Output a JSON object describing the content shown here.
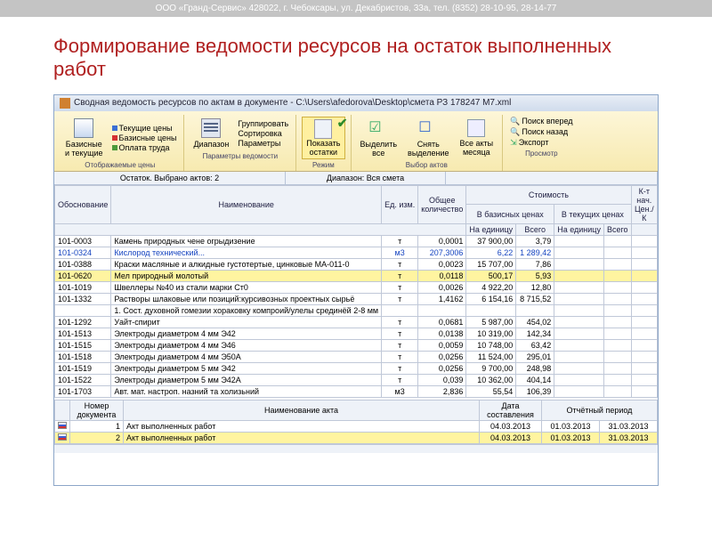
{
  "page": {
    "header": "ООО «Гранд-Сервис» 428022, г. Чебоксары, ул. Декабристов, 33а, тел. (8352) 28-10-95, 28-14-77",
    "title": "Формирование ведомости ресурсов на остаток выполненных работ"
  },
  "window": {
    "title": "Сводная ведомость ресурсов по актам в документе - C:\\Users\\afedorova\\Desktop\\смета РЗ 178247 М7.xml"
  },
  "ribbon": {
    "g1": {
      "big": "Базисные\nи текущие",
      "i1": "Текущие цены",
      "i2": "Базисные цены",
      "i3": "Оплата труда",
      "label": "Отображаемые цены"
    },
    "g2": {
      "big": "Диапазон",
      "i1": "Группировать",
      "i2": "Сортировка",
      "i3": "Параметры",
      "label": "Параметры ведомости"
    },
    "g3": {
      "big": "Показать\nостатки",
      "label": "Режим"
    },
    "g4": {
      "b1": "Выделить\nвсе",
      "b2": "Снять\nвыделение",
      "b3": "Все акты\nмесяца",
      "label": "Выбор актов"
    },
    "g5": {
      "i1": "Поиск вперед",
      "i2": "Поиск назад",
      "i3": "Экспорт",
      "label": "Просмотр"
    }
  },
  "subheader": {
    "s1": "Остаток. Выбрано актов: 2",
    "s2": "Диапазон: Вся смета"
  },
  "columns": {
    "code": "Обоснование",
    "name": "Наименование",
    "unit": "Ед. изм.",
    "qty_group": "Общее\nколичество",
    "base_group": "В базисных ценах",
    "cur_group": "В текущих ценах",
    "perunit": "На единицу",
    "total": "Всего",
    "right": "К-т\nнач.\nЦен./К"
  },
  "main_group": "Стоимость",
  "rows": [
    {
      "code": "101-0003",
      "name": "Камень природных чене огрыдизение",
      "unit": "т",
      "n1": "0,0001",
      "n2": "37 900,00",
      "n3": "3,79"
    },
    {
      "code": "101-0324",
      "name": "Кислород технический...",
      "unit": "м3",
      "n1": "207,3006",
      "n2": "6,22",
      "n3": "1 289,42",
      "blue": true
    },
    {
      "code": "101-0388",
      "name": "Краски масляные и алкидные густотертые, цинковые МА-011-0",
      "unit": "т",
      "n1": "0,0023",
      "n2": "15 707,00",
      "n3": "7,86"
    },
    {
      "code": "101-0620",
      "name": "Мел природный молотый",
      "unit": "т",
      "n1": "0,0118",
      "n2": "500,17",
      "n3": "5,93",
      "hl": true
    },
    {
      "code": "101-1019",
      "name": "Швеллеры №40 из стали марки Ст0",
      "unit": "т",
      "n1": "0,0026",
      "n2": "4 922,20",
      "n3": "12,80"
    },
    {
      "code": "101-1332",
      "name": "Растворы шлаковые или позиций:курсивозных проектных сырьё",
      "unit": "т",
      "n1": "1,4162",
      "n2": "6 154,16",
      "n3": "8 715,52"
    },
    {
      "code": "",
      "name": "1. Сост. духовной гомезии хораковку компроий/улелы срединёй 2-8 мм",
      "unit": "",
      "n1": "",
      "n2": "",
      "n3": ""
    },
    {
      "code": "101-1292",
      "name": "Уайт-спирит",
      "unit": "т",
      "n1": "0,0681",
      "n2": "5 987,00",
      "n3": "454,02"
    },
    {
      "code": "101-1513",
      "name": "Электроды диаметром 4 мм Э42",
      "unit": "т",
      "n1": "0,0138",
      "n2": "10 319,00",
      "n3": "142,34"
    },
    {
      "code": "101-1515",
      "name": "Электроды диаметром 4 мм Э46",
      "unit": "т",
      "n1": "0,0059",
      "n2": "10 748,00",
      "n3": "63,42"
    },
    {
      "code": "101-1518",
      "name": "Электроды диаметром 4 мм Э50А",
      "unit": "т",
      "n1": "0,0256",
      "n2": "11 524,00",
      "n3": "295,01"
    },
    {
      "code": "101-1519",
      "name": "Электроды диаметром 5 мм Э42",
      "unit": "т",
      "n1": "0,0256",
      "n2": "9 700,00",
      "n3": "248,98"
    },
    {
      "code": "101-1522",
      "name": "Электроды диаметром 5 мм Э42А",
      "unit": "т",
      "n1": "0,039",
      "n2": "10 362,00",
      "n3": "404,14"
    },
    {
      "code": "101-1703",
      "name": "Авт. мат. настроп. назний та холизьний",
      "unit": "м3",
      "n1": "2,836",
      "n2": "55,54",
      "n3": "106,39"
    }
  ],
  "acts": {
    "columns": {
      "num": "Номер\nдокумента",
      "name": "Наименование акта",
      "date": "Дата\nсоставления",
      "period": "Отчётный период"
    },
    "rows": [
      {
        "num": "1",
        "name": "Акт выполненных работ",
        "date": "04.03.2013",
        "p1": "01.03.2013",
        "p2": "31.03.2013"
      },
      {
        "num": "2",
        "name": "Акт выполненных работ",
        "date": "04.03.2013",
        "p1": "01.03.2013",
        "p2": "31.03.2013",
        "hl": true
      }
    ]
  }
}
